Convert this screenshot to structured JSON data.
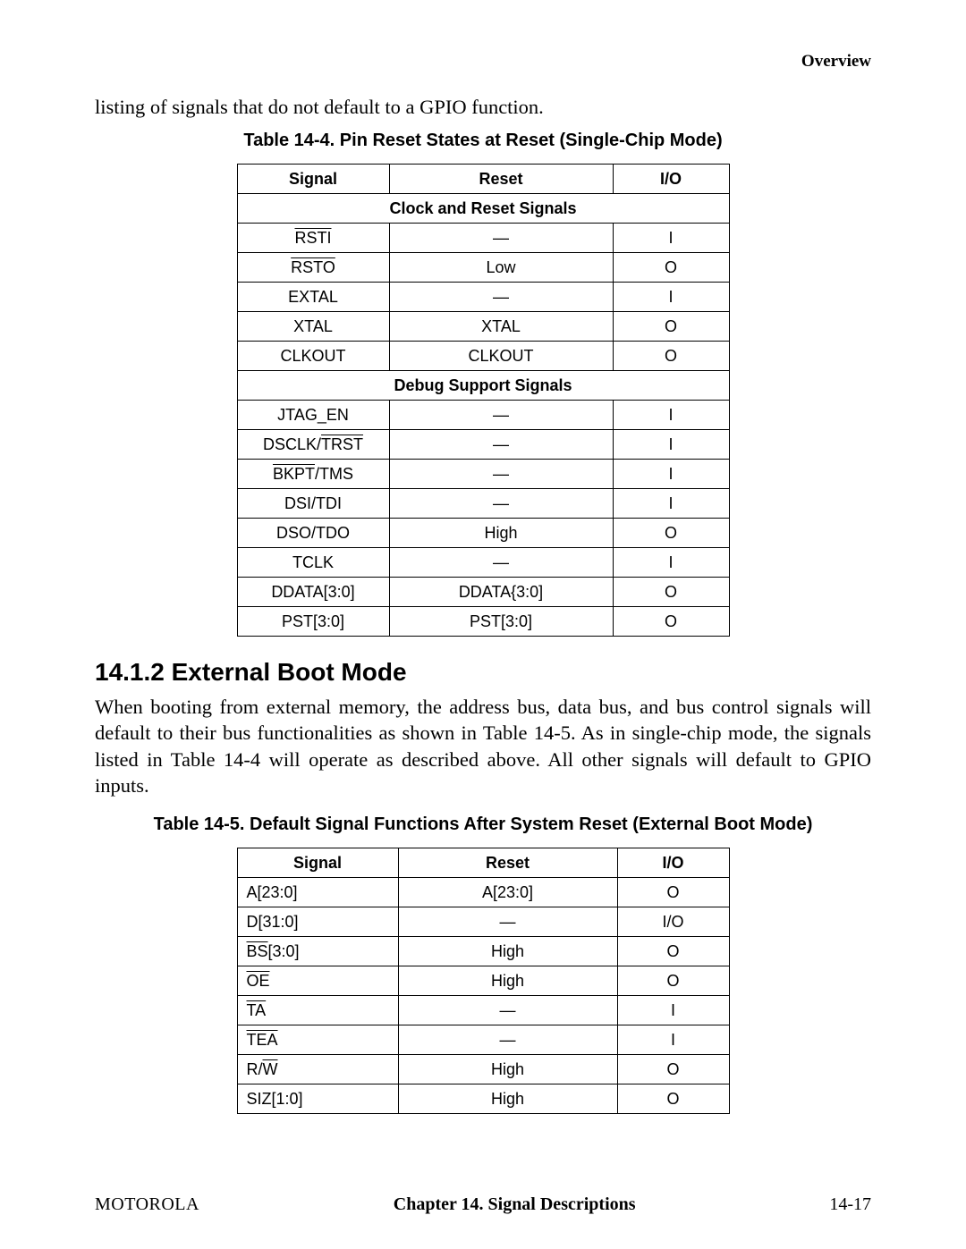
{
  "header_section": "Overview",
  "intro_text": "listing of signals that do not default to a GPIO function.",
  "tables": {
    "t144": {
      "title": "Table 14-4. Pin Reset States at Reset (Single-Chip Mode)",
      "headers": {
        "signal": "Signal",
        "reset": "Reset",
        "io": "I/O"
      },
      "section1": "Clock and Reset Signals",
      "rows1": [
        {
          "signal_html": "<span class=\"over\">RSTI</span>",
          "reset": "—",
          "io": "I"
        },
        {
          "signal_html": "<span class=\"over\">RSTO</span>",
          "reset": "Low",
          "io": "O"
        },
        {
          "signal_html": "EXTAL",
          "reset": "—",
          "io": "I"
        },
        {
          "signal_html": "XTAL",
          "reset": "XTAL",
          "io": "O"
        },
        {
          "signal_html": "CLKOUT",
          "reset": "CLKOUT",
          "io": "O"
        }
      ],
      "section2": "Debug Support Signals",
      "rows2": [
        {
          "signal_html": "JTAG_EN",
          "reset": "—",
          "io": "I"
        },
        {
          "signal_html": "DSCLK/<span class=\"over\">TRST</span>",
          "reset": "—",
          "io": "I"
        },
        {
          "signal_html": "<span class=\"over\">BKPT</span>/TMS",
          "reset": "—",
          "io": "I"
        },
        {
          "signal_html": "DSI/TDI",
          "reset": "—",
          "io": "I"
        },
        {
          "signal_html": "DSO/TDO",
          "reset": "High",
          "io": "O"
        },
        {
          "signal_html": "TCLK",
          "reset": "—",
          "io": "I"
        },
        {
          "signal_html": "DDATA[3:0]",
          "reset": "DDATA{3:0]",
          "io": "O"
        },
        {
          "signal_html": "PST[3:0]",
          "reset": "PST[3:0]",
          "io": "O"
        }
      ]
    },
    "t145": {
      "title": "Table 14-5. Default Signal Functions After System Reset (External Boot Mode)",
      "headers": {
        "signal": "Signal",
        "reset": "Reset",
        "io": "I/O"
      },
      "rows": [
        {
          "signal_html": "A[23:0]",
          "reset": "A[23:0]",
          "io": "O"
        },
        {
          "signal_html": "D[31:0]",
          "reset": "—",
          "io": "I/O"
        },
        {
          "signal_html": "<span class=\"over\">BS</span>[3:0]",
          "reset": "High",
          "io": "O"
        },
        {
          "signal_html": "<span class=\"over\">OE</span>",
          "reset": "High",
          "io": "O"
        },
        {
          "signal_html": "<span class=\"over\">TA</span>",
          "reset": "—",
          "io": "I"
        },
        {
          "signal_html": "<span class=\"over\">TEA</span>",
          "reset": "—",
          "io": "I"
        },
        {
          "signal_html": "R/<span class=\"over\">W</span>",
          "reset": "High",
          "io": "O"
        },
        {
          "signal_html": "SIZ[1:0]",
          "reset": "High",
          "io": "O"
        }
      ]
    }
  },
  "section_heading": "14.1.2  External Boot Mode",
  "section_paragraph": "When booting from external memory, the address bus, data bus, and bus control signals will default to their bus functionalities as shown in Table 14-5. As in single-chip mode, the signals listed in Table 14-4 will operate as described above. All other signals will default to GPIO inputs.",
  "footer": {
    "brand": "MOTOROLA",
    "chapter": "Chapter 14.  Signal Descriptions",
    "page": "14-17"
  }
}
